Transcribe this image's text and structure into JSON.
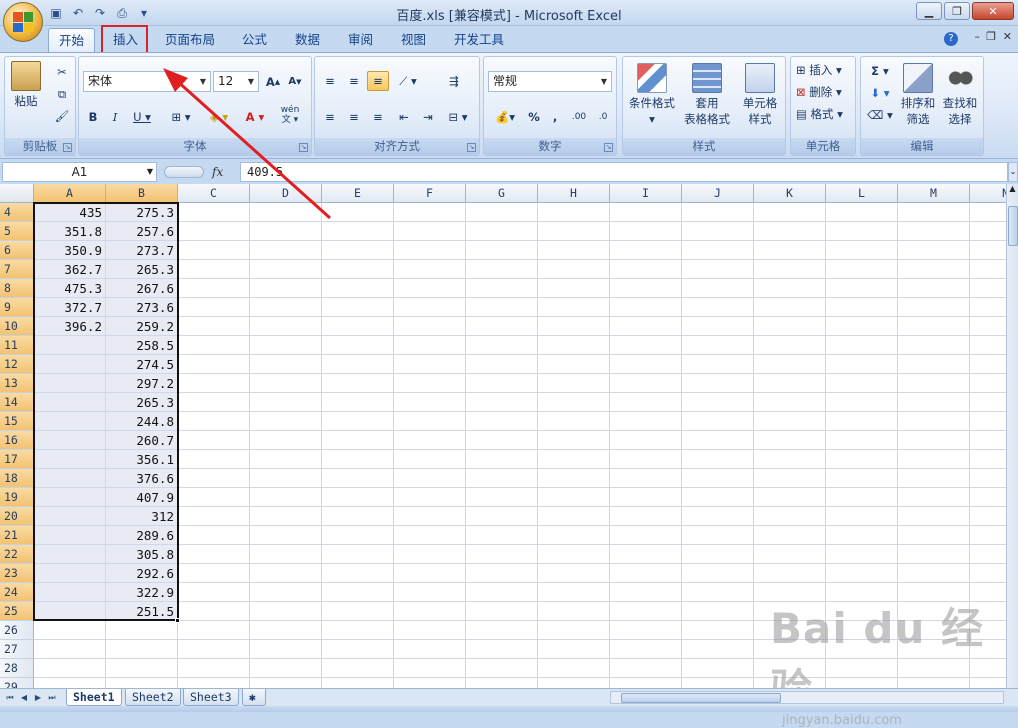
{
  "window": {
    "title": "百度.xls  [兼容模式] - Microsoft Excel"
  },
  "ribbon_tabs": [
    "开始",
    "插入",
    "页面布局",
    "公式",
    "数据",
    "审阅",
    "视图",
    "开发工具"
  ],
  "ribbon": {
    "clipboard": {
      "paste_label": "粘贴",
      "group_label": "剪贴板"
    },
    "font": {
      "font_name": "宋体",
      "font_size": "12",
      "group_label": "字体",
      "phonetic": "wén"
    },
    "alignment": {
      "group_label": "对齐方式"
    },
    "number": {
      "format": "常规",
      "group_label": "数字"
    },
    "styles": {
      "conditional_format": "条件格式",
      "table_format_line1": "套用",
      "table_format_line2": "表格格式",
      "cell_style_line1": "单元格",
      "cell_style_line2": "样式",
      "group_label": "样式"
    },
    "cells": {
      "insert": "插入",
      "delete": "删除",
      "format": "格式",
      "group_label": "单元格"
    },
    "editing": {
      "sort_line1": "排序和",
      "sort_line2": "筛选",
      "find_line1": "查找和",
      "find_line2": "选择",
      "group_label": "编辑"
    }
  },
  "formula_bar": {
    "name_box": "A1",
    "fx": "fx",
    "value": "409.5"
  },
  "grid": {
    "columns": [
      "A",
      "B",
      "C",
      "D",
      "E",
      "F",
      "G",
      "H",
      "I",
      "J",
      "K",
      "L",
      "M",
      "N"
    ],
    "row_numbers": [
      "4",
      "5",
      "6",
      "7",
      "8",
      "9",
      "10",
      "11",
      "12",
      "13",
      "14",
      "15",
      "16",
      "17",
      "18",
      "19",
      "20",
      "21",
      "22",
      "23",
      "24",
      "25",
      "26",
      "27",
      "28",
      "29"
    ],
    "col_a": [
      "435",
      "351.8",
      "350.9",
      "362.7",
      "475.3",
      "372.7",
      "396.2",
      "",
      "",
      "",
      "",
      "",
      "",
      "",
      "",
      "",
      "",
      "",
      "",
      "",
      "",
      "",
      "",
      "",
      "",
      ""
    ],
    "col_b": [
      "275.3",
      "257.6",
      "273.7",
      "265.3",
      "267.6",
      "273.6",
      "259.2",
      "258.5",
      "274.5",
      "297.2",
      "265.3",
      "244.8",
      "260.7",
      "356.1",
      "376.6",
      "407.9",
      "312",
      "289.6",
      "305.8",
      "292.6",
      "322.9",
      "251.5",
      "",
      "",
      "",
      ""
    ]
  },
  "sheets": [
    "Sheet1",
    "Sheet2",
    "Sheet3"
  ],
  "watermark": {
    "main": "Bai du 经验",
    "sub": "jingyan.baidu.com"
  },
  "colors": {
    "highlight_box": "#d7242a",
    "arrow": "#e02020",
    "selected_header": "#f3c272"
  }
}
